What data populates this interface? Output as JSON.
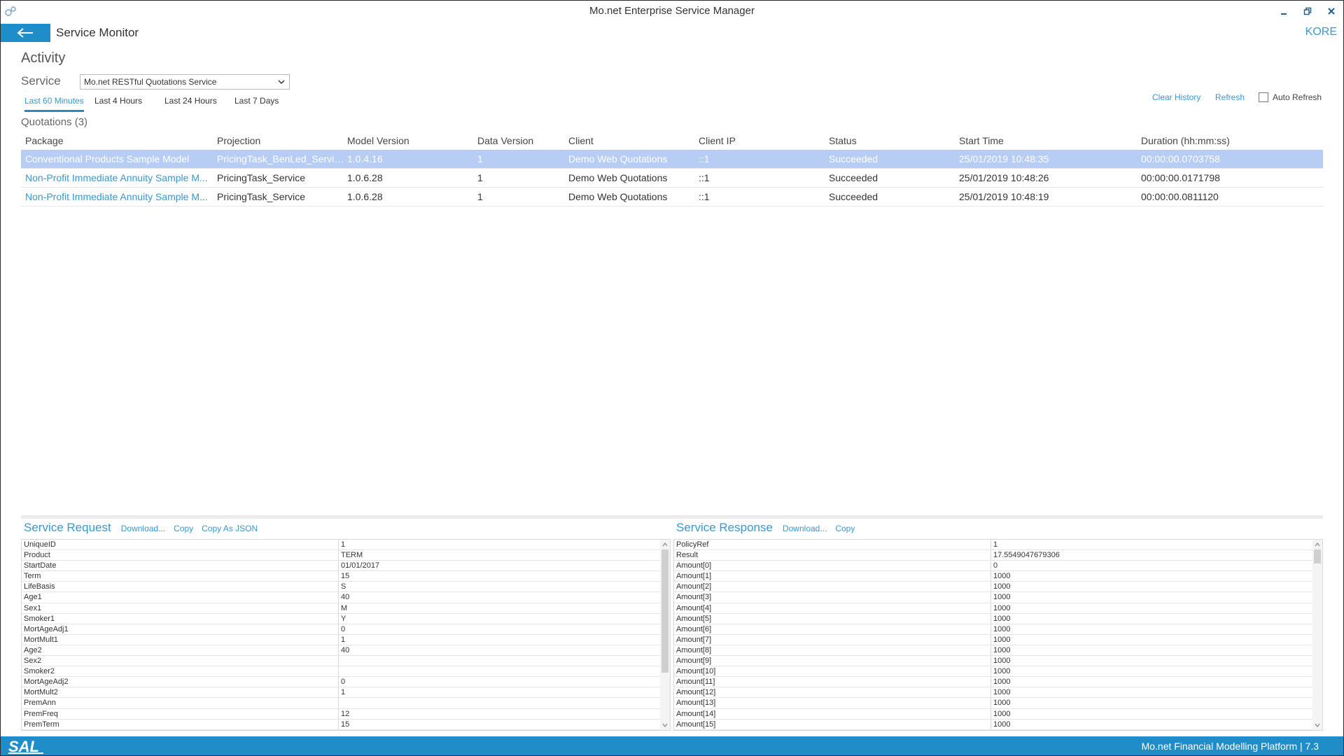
{
  "window": {
    "title": "Mo.net Enterprise Service Manager",
    "minimize_icon": "minimize-icon",
    "maximize_icon": "restore-icon",
    "close_icon": "close-icon"
  },
  "navbar": {
    "back_icon": "arrow-left-icon",
    "title": "Service Monitor",
    "user": "KORE"
  },
  "activity": {
    "heading": "Activity",
    "service_label": "Service",
    "service_selected": "Mo.net RESTful Quotations Service",
    "tabs": [
      {
        "label": "Last 60 Minutes",
        "active": true
      },
      {
        "label": "Last 4 Hours",
        "active": false
      },
      {
        "label": "Last 24 Hours",
        "active": false
      },
      {
        "label": "Last 7 Days",
        "active": false
      }
    ],
    "clear_history": "Clear History",
    "refresh": "Refresh",
    "auto_refresh": "Auto Refresh",
    "auto_refresh_checked": false
  },
  "quotations": {
    "label": "Quotations (3)",
    "columns": [
      "Package",
      "Projection",
      "Model Version",
      "Data Version",
      "Client",
      "Client IP",
      "Status",
      "Start Time",
      "Duration (hh:mm:ss)"
    ],
    "rows": [
      [
        "Conventional Products Sample Model",
        "PricingTask_BenLed_Service",
        "1.0.4.16",
        "1",
        "Demo Web Quotations",
        "::1",
        "Succeeded",
        "25/01/2019 10:48:35",
        "00:00:00.0703758"
      ],
      [
        "Non-Profit Immediate Annuity Sample M...",
        "PricingTask_Service",
        "1.0.6.28",
        "1",
        "Demo Web Quotations",
        "::1",
        "Succeeded",
        "25/01/2019 10:48:26",
        "00:00:00.0171798"
      ],
      [
        "Non-Profit Immediate Annuity Sample M...",
        "PricingTask_Service",
        "1.0.6.28",
        "1",
        "Demo Web Quotations",
        "::1",
        "Succeeded",
        "25/01/2019 10:48:19",
        "00:00:00.0811120"
      ]
    ],
    "selected_row": 0
  },
  "request": {
    "title": "Service Request",
    "download": "Download...",
    "copy": "Copy",
    "copy_json": "Copy As JSON",
    "rows": [
      [
        "UniqueID",
        "1"
      ],
      [
        "Product",
        "TERM"
      ],
      [
        "StartDate",
        "01/01/2017"
      ],
      [
        "Term",
        "15"
      ],
      [
        "LifeBasis",
        "S"
      ],
      [
        "Age1",
        "40"
      ],
      [
        "Sex1",
        "M"
      ],
      [
        "Smoker1",
        "Y"
      ],
      [
        "MortAgeAdj1",
        "0"
      ],
      [
        "MortMult1",
        "1"
      ],
      [
        "Age2",
        "40"
      ],
      [
        "Sex2",
        ""
      ],
      [
        "Smoker2",
        ""
      ],
      [
        "MortAgeAdj2",
        "0"
      ],
      [
        "MortMult2",
        "1"
      ],
      [
        "PremAnn",
        ""
      ],
      [
        "PremFreq",
        "12"
      ],
      [
        "PremTerm",
        "15"
      ]
    ]
  },
  "response": {
    "title": "Service Response",
    "download": "Download...",
    "copy": "Copy",
    "rows": [
      [
        "PolicyRef",
        "1"
      ],
      [
        "Result",
        "17.5549047679306"
      ],
      [
        "Amount[0]",
        "0"
      ],
      [
        "Amount[1]",
        "1000"
      ],
      [
        "Amount[2]",
        "1000"
      ],
      [
        "Amount[3]",
        "1000"
      ],
      [
        "Amount[4]",
        "1000"
      ],
      [
        "Amount[5]",
        "1000"
      ],
      [
        "Amount[6]",
        "1000"
      ],
      [
        "Amount[7]",
        "1000"
      ],
      [
        "Amount[8]",
        "1000"
      ],
      [
        "Amount[9]",
        "1000"
      ],
      [
        "Amount[10]",
        "1000"
      ],
      [
        "Amount[11]",
        "1000"
      ],
      [
        "Amount[12]",
        "1000"
      ],
      [
        "Amount[13]",
        "1000"
      ],
      [
        "Amount[14]",
        "1000"
      ],
      [
        "Amount[15]",
        "1000"
      ]
    ]
  },
  "statusbar": {
    "logo": "SAL",
    "text": "Mo.net Financial Modelling Platform | 7.3"
  },
  "colors": {
    "accent": "#1f8ec8",
    "link": "#3a97cf",
    "selected_row": "#b7cdf3"
  }
}
